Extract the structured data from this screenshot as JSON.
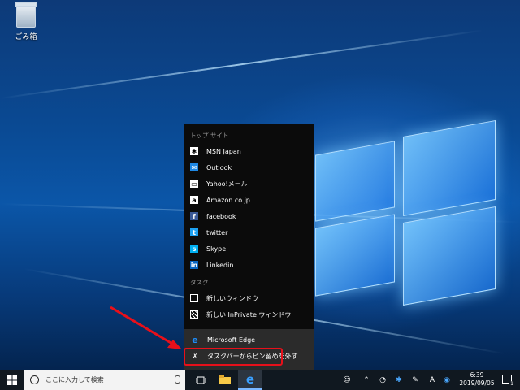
{
  "desktop": {
    "recycle_bin_label": "ごみ箱"
  },
  "jump_list": {
    "top_sites_header": "トップ サイト",
    "top_sites": [
      {
        "label": "MSN Japan",
        "icon": "msn-icon"
      },
      {
        "label": "Outlook",
        "icon": "outlook-icon"
      },
      {
        "label": "Yahoo!メール",
        "icon": "yahoo-mail-icon"
      },
      {
        "label": "Amazon.co.jp",
        "icon": "amazon-icon"
      },
      {
        "label": "facebook",
        "icon": "facebook-icon"
      },
      {
        "label": "twitter",
        "icon": "twitter-icon"
      },
      {
        "label": "Skype",
        "icon": "skype-icon"
      },
      {
        "label": "Linkedin",
        "icon": "linkedin-icon"
      }
    ],
    "tasks_header": "タスク",
    "tasks": [
      {
        "label": "新しいウィンドウ",
        "icon": "window-icon"
      },
      {
        "label": "新しい InPrivate ウィンドウ",
        "icon": "inprivate-window-icon"
      }
    ],
    "app_name": "Microsoft Edge",
    "unpin_label": "タスクバーからピン留めを外す"
  },
  "taskbar": {
    "search_placeholder": "ここに入力して検索",
    "ime_indicator": "A",
    "clock_time": "6:39",
    "clock_date": "2019/09/05",
    "notification_count": "1"
  },
  "colors": {
    "highlight_red": "#e8101a",
    "edge_blue": "#1e90ff",
    "menu_bg": "#0b0b0b"
  }
}
